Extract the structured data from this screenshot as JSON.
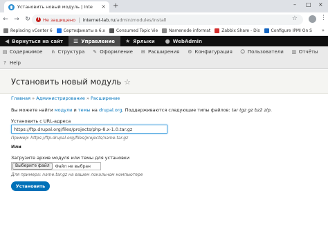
{
  "browser": {
    "tab_title": "Установить новый модуль | Inte",
    "tab_close": "×",
    "new_tab": "+",
    "window_controls": [
      "–",
      "□",
      "×"
    ],
    "nav": [
      "←",
      "→",
      "↻"
    ],
    "security_label": "Не защищено",
    "url_host": "internet-lab.ru",
    "url_path": "/admin/modules/install",
    "bookmark_star": "☆",
    "menu": "⋮"
  },
  "bookmarks": [
    {
      "label": "Replacing vCenter 6",
      "color": "#7b7b7b"
    },
    {
      "label": "Сертификаты в 6.x",
      "color": "#1a73e8"
    },
    {
      "label": "Consumed Topic Vie",
      "color": "#555555"
    },
    {
      "label": "Namenode informat",
      "color": "#888888"
    },
    {
      "label": "Zabbix Share - Dis",
      "color": "#d32f2f"
    },
    {
      "label": "Configure IPMI On S",
      "color": "#1565c0"
    }
  ],
  "bookmarks_more": "»",
  "admin_bar": [
    {
      "label": "Вернуться на сайт",
      "icon": "◀",
      "active": false
    },
    {
      "label": "Управление",
      "icon": "☰",
      "active": true
    },
    {
      "label": "Ярлыки",
      "icon": "★",
      "active": false
    },
    {
      "label": "WebAdmin",
      "icon": "●",
      "active": false
    }
  ],
  "admin_tray": {
    "row1": [
      {
        "label": "Содержимое",
        "icon": "▤"
      },
      {
        "label": "Структура",
        "icon": "⋔"
      },
      {
        "label": "Оформление",
        "icon": "✎"
      },
      {
        "label": "Расширения",
        "icon": "⊞"
      },
      {
        "label": "Конфигурация",
        "icon": "⚙"
      },
      {
        "label": "Пользователи",
        "icon": "☺"
      },
      {
        "label": "Отчёты",
        "icon": "▥"
      }
    ],
    "row2": [
      {
        "label": "Help",
        "icon": "?"
      }
    ]
  },
  "page": {
    "title": "Установить новый модуль",
    "shortcut_star": "☆"
  },
  "breadcrumb": {
    "items": [
      "Главная",
      "Администрирование",
      "Расширение"
    ],
    "separator": "»"
  },
  "intro": {
    "prefix": "Вы можете найти ",
    "link_modules": "модули",
    "and": " и ",
    "link_themes": "темы",
    "on": " на ",
    "link_site": "drupal.org",
    "suffix": ". Поддерживаются следующие типы файлов: ",
    "extensions": "tar tgz gz bz2 zip",
    "end": "."
  },
  "form": {
    "url_label": "Установить с URL-адреса",
    "url_value": "https://ftp.drupal.org/files/projects/php-8.x-1.0.tar.gz",
    "url_hint": "Пример: https://ftp.drupal.org/files/projects/name.tar.gz",
    "or_label": "Или",
    "upload_label": "Загрузите архив модуля или темы для установки",
    "file_button": "Выберите файл",
    "file_status": "Файл не выбран",
    "upload_hint": "Для примера: name.tar.gz на вашем локальном компьютере",
    "submit": "Установить"
  }
}
